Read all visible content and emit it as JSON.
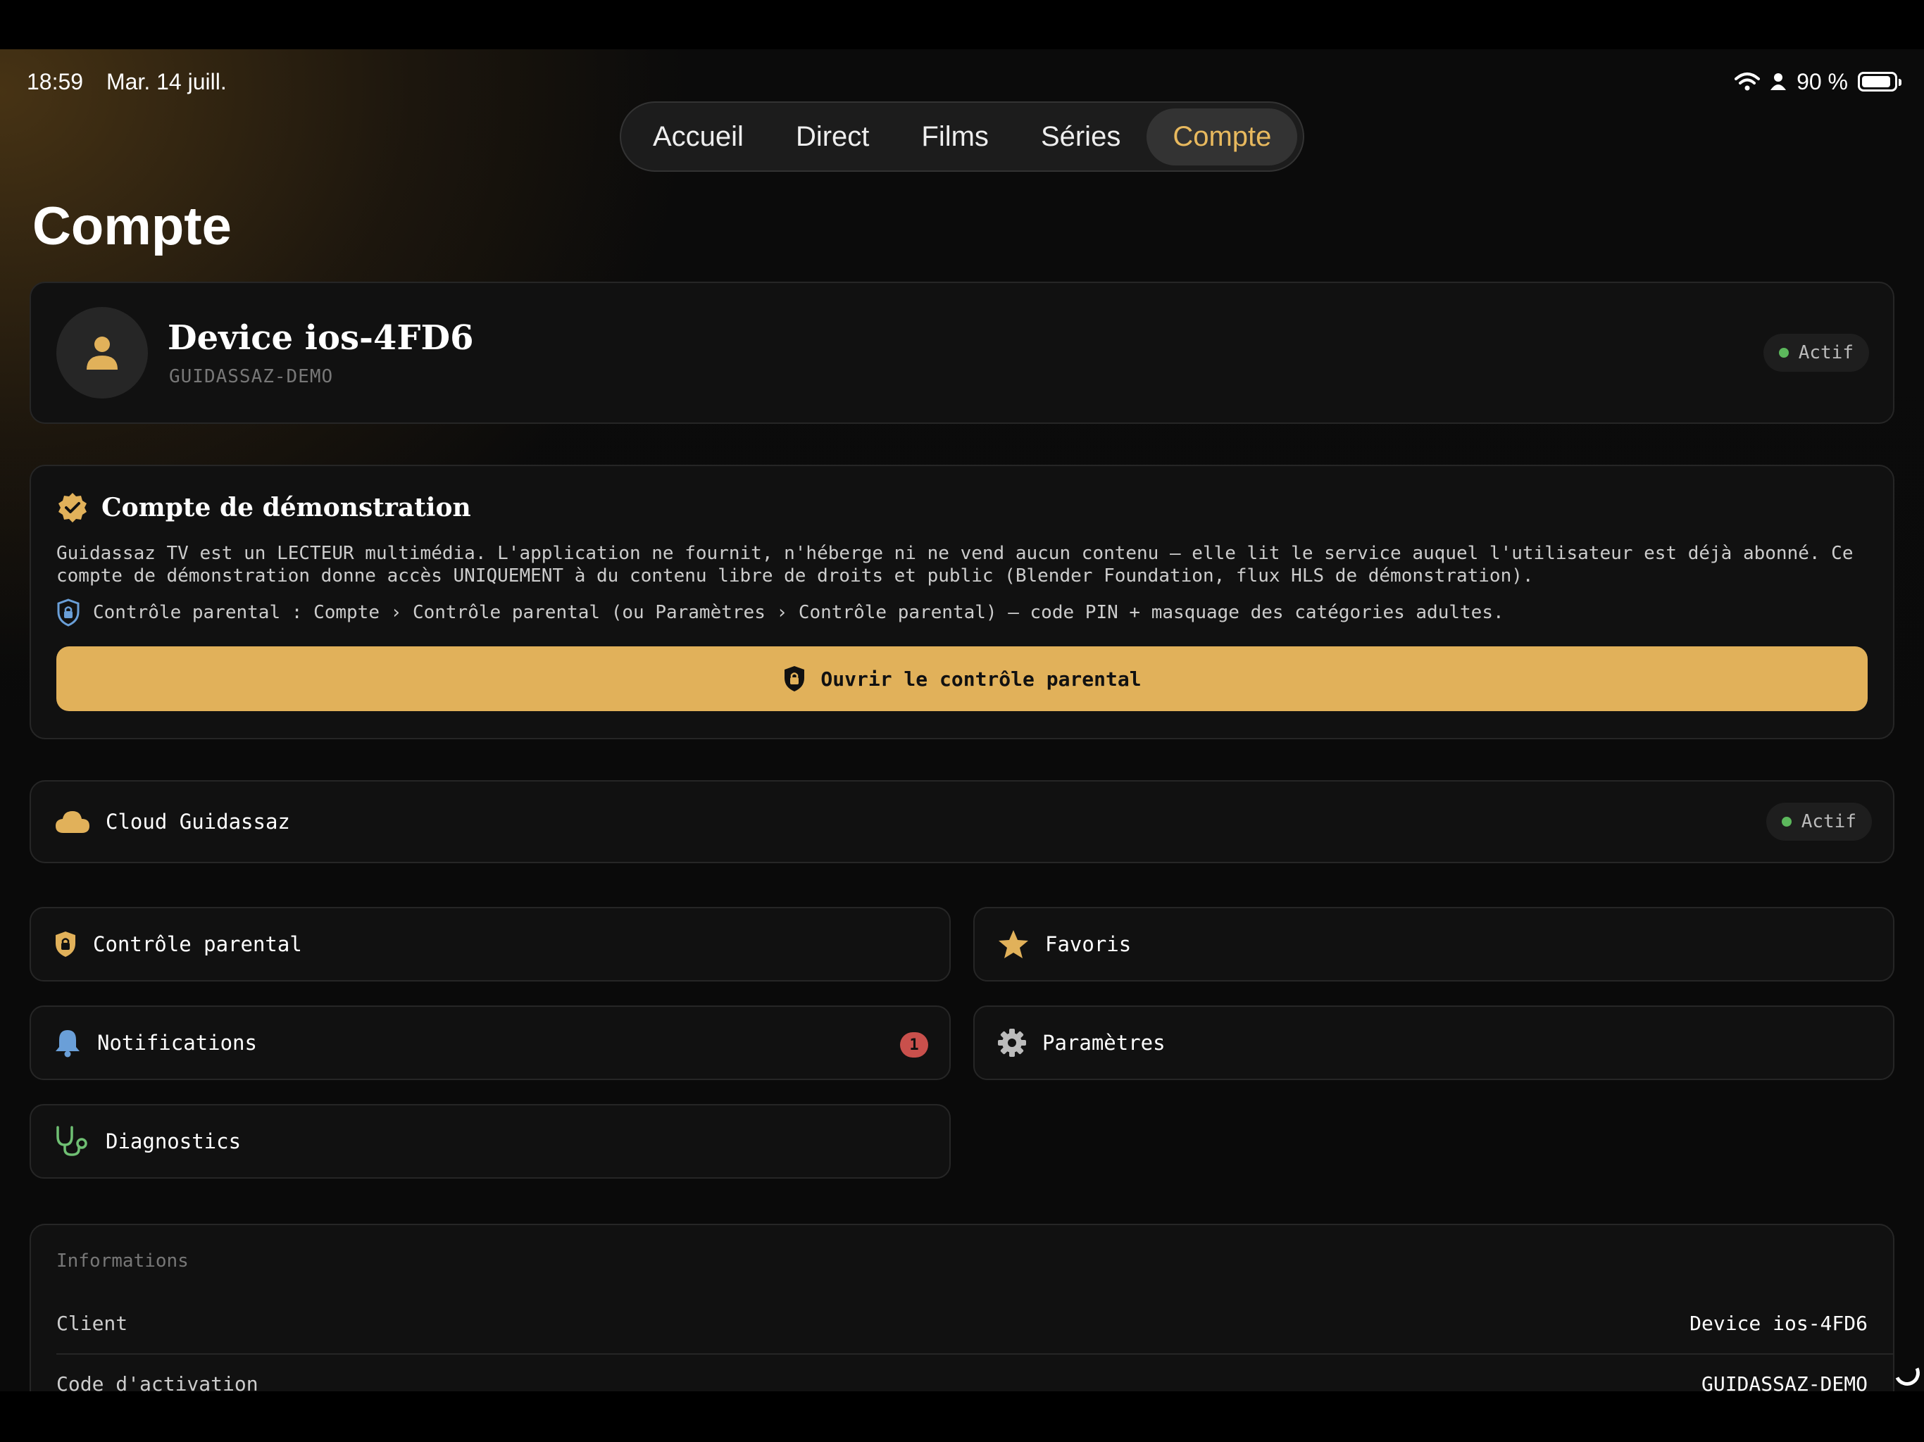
{
  "status_bar": {
    "time": "18:59",
    "date": "Mar. 14 juill.",
    "battery_label": "90 %",
    "battery_level_pct": 90
  },
  "tabs": [
    {
      "label": "Accueil",
      "active": false
    },
    {
      "label": "Direct",
      "active": false
    },
    {
      "label": "Films",
      "active": false
    },
    {
      "label": "Séries",
      "active": false
    },
    {
      "label": "Compte",
      "active": true
    }
  ],
  "page": {
    "title": "Compte"
  },
  "profile": {
    "name": "Device ios-4FD6",
    "code": "GUIDASSAZ-DEMO",
    "status": "Actif"
  },
  "demo": {
    "title": "Compte de démonstration",
    "description": "Guidassaz TV est un LECTEUR multimédia. L'application ne fournit, n'héberge ni ne vend aucun contenu — elle lit le service auquel l'utilisateur est déjà abonné. Ce compte de démonstration donne accès UNIQUEMENT à du contenu libre de droits et public (Blender Foundation, flux HLS de démonstration).",
    "hint": "Contrôle parental : Compte › Contrôle parental (ou Paramètres › Contrôle parental) — code PIN + masquage des catégories adultes.",
    "cta": "Ouvrir le contrôle parental"
  },
  "cloud": {
    "label": "Cloud Guidassaz",
    "status": "Actif"
  },
  "menu": {
    "parental": "Contrôle parental",
    "favorites": "Favoris",
    "notifications": "Notifications",
    "notifications_count": "1",
    "settings": "Paramètres",
    "diagnostics": "Diagnostics"
  },
  "info": {
    "title": "Informations",
    "rows": [
      {
        "key": "Client",
        "value": "Device ios-4FD6"
      },
      {
        "key": "Code d'activation",
        "value": "GUIDASSAZ-DEMO"
      }
    ]
  },
  "colors": {
    "accent": "#e1b15a",
    "status_green": "#5cb85c",
    "badge_red": "#c9504c",
    "diag_green": "#6fbf73",
    "bell_blue": "#6a9fd8"
  }
}
